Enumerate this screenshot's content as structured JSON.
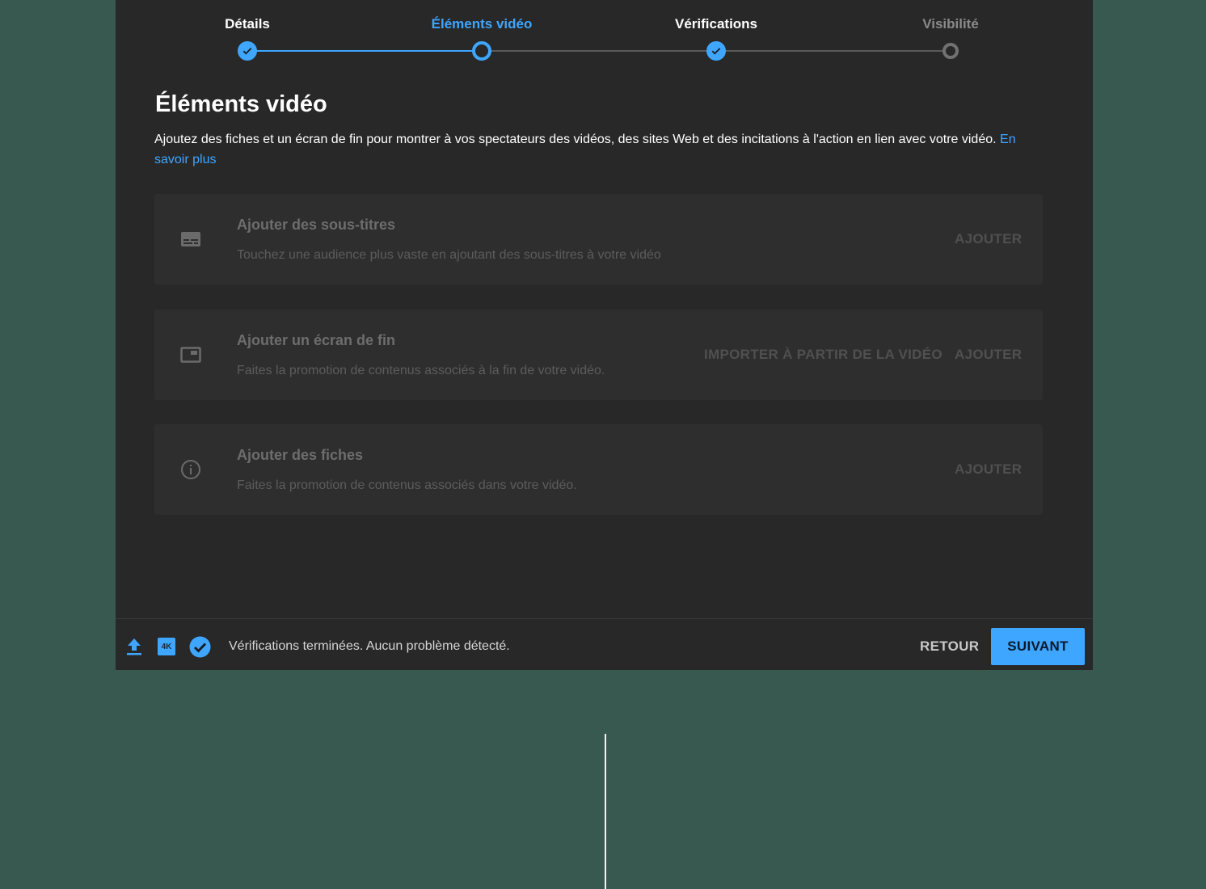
{
  "stepper": {
    "steps": [
      {
        "label": "Détails",
        "state": "done"
      },
      {
        "label": "Éléments vidéo",
        "state": "current"
      },
      {
        "label": "Vérifications",
        "state": "done"
      },
      {
        "label": "Visibilité",
        "state": "pending"
      }
    ]
  },
  "main": {
    "title": "Éléments vidéo",
    "description": "Ajoutez des fiches et un écran de fin pour montrer à vos spectateurs des vidéos, des sites Web et des incitations à l'action en lien avec votre vidéo.",
    "learn_more": "En savoir plus"
  },
  "cards": [
    {
      "icon": "subtitles-icon",
      "title": "Ajouter des sous-titres",
      "subtitle": "Touchez une audience plus vaste en ajoutant des sous-titres à votre vidéo",
      "add_label": "AJOUTER"
    },
    {
      "icon": "end-screen-icon",
      "title": "Ajouter un écran de fin",
      "subtitle": "Faites la promotion de contenus associés à la fin de votre vidéo.",
      "import_label": "IMPORTER À PARTIR DE LA VIDÉO",
      "add_label": "AJOUTER"
    },
    {
      "icon": "info-icon",
      "title": "Ajouter des fiches",
      "subtitle": "Faites la promotion de contenus associés dans votre vidéo.",
      "add_label": "AJOUTER"
    }
  ],
  "footer": {
    "hd_badge": "4K",
    "status": "Vérifications terminées. Aucun problème détecté.",
    "back_label": "RETOUR",
    "next_label": "SUIVANT"
  },
  "colors": {
    "accent": "#3ea6ff",
    "dialog_bg": "#282828",
    "page_bg": "#385950"
  }
}
